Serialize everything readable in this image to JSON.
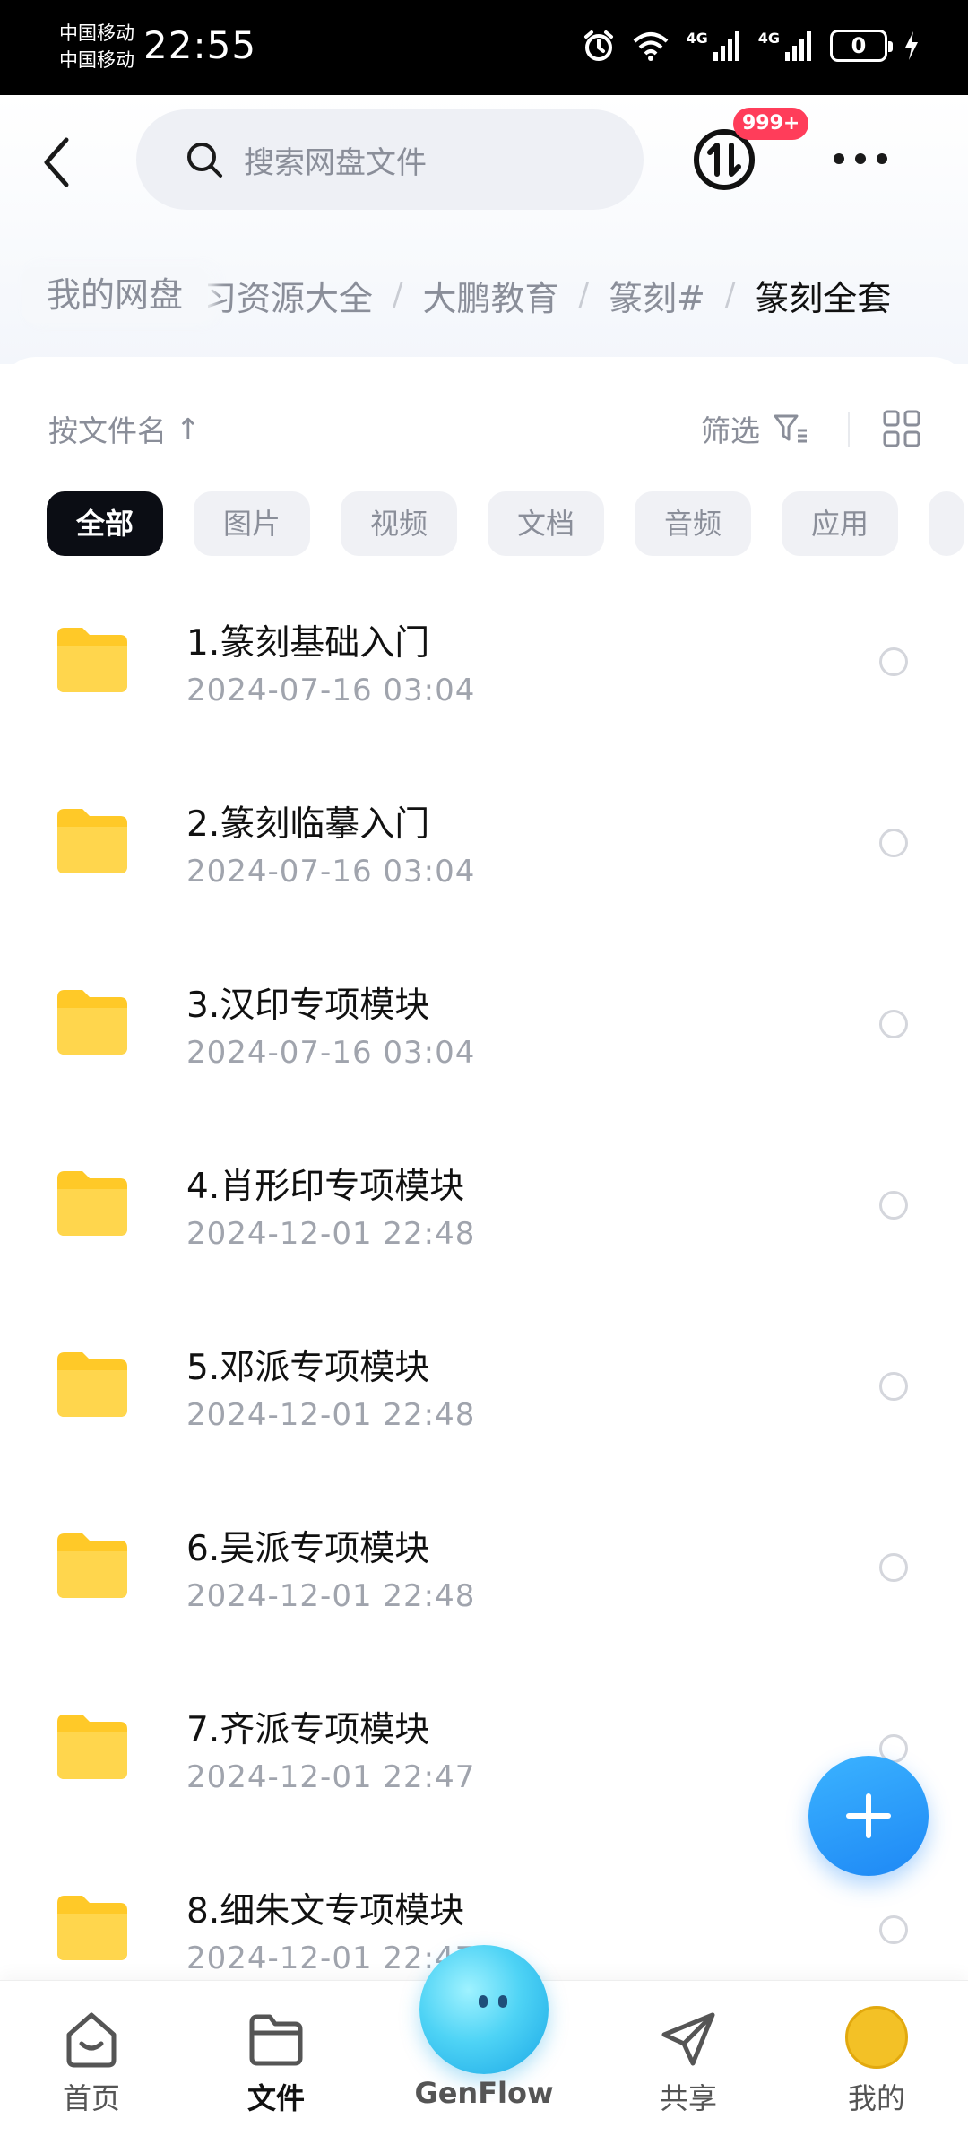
{
  "status_bar": {
    "carrier_1": "中国移动",
    "carrier_2": "中国移动",
    "time": "22:55",
    "network_1": "4G",
    "network_2": "4G",
    "battery": "0"
  },
  "header": {
    "search_placeholder": "搜索网盘文件",
    "transfer_badge": "999+"
  },
  "breadcrumb": {
    "root": "我的网盘",
    "items": [
      "习资源大全",
      "大鹏教育",
      "篆刻#",
      "篆刻全套"
    ],
    "separator": "/"
  },
  "toolbar": {
    "sort_label": "按文件名",
    "sort_arrow": "↑",
    "filter_label": "筛选"
  },
  "chips": [
    "全部",
    "图片",
    "视频",
    "文档",
    "音频",
    "应用"
  ],
  "files": [
    {
      "name": "1.篆刻基础入门",
      "date": "2024-07-16  03:04"
    },
    {
      "name": "2.篆刻临摹入门",
      "date": "2024-07-16  03:04"
    },
    {
      "name": "3.汉印专项模块",
      "date": "2024-07-16  03:04"
    },
    {
      "name": "4.肖形印专项模块",
      "date": "2024-12-01  22:48"
    },
    {
      "name": "5.邓派专项模块",
      "date": "2024-12-01  22:48"
    },
    {
      "name": "6.吴派专项模块",
      "date": "2024-12-01  22:48"
    },
    {
      "name": "7.齐派专项模块",
      "date": "2024-12-01  22:47"
    },
    {
      "name": "8.细朱文专项模块",
      "date": "2024-12-01  22:47"
    }
  ],
  "bottom_nav": {
    "home": "首页",
    "files": "文件",
    "genflow": "GenFlow",
    "share": "共享",
    "mine": "我的"
  },
  "colors": {
    "accent": "#1e88f5",
    "folder": "#ffc928",
    "badge": "#ff3d5a",
    "active_chip": "#0b0d14"
  }
}
